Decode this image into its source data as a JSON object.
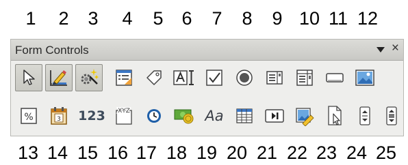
{
  "top_numbers": [
    "1",
    "2",
    "3",
    "4",
    "5",
    "6",
    "7",
    "8",
    "9",
    "10",
    "11",
    "12"
  ],
  "bottom_numbers": [
    "13",
    "14",
    "15",
    "16",
    "17",
    "18",
    "19",
    "20",
    "21",
    "22",
    "23",
    "24",
    "25"
  ],
  "toolbar": {
    "title": "Form Controls",
    "menu_icon": "dropdown-arrow-icon",
    "close_icon": "close-icon",
    "close_glyph": "×"
  },
  "row1": [
    {
      "icon": "select-pointer-icon",
      "active": true
    },
    {
      "icon": "design-mode-icon",
      "active": true
    },
    {
      "icon": "control-wizards-icon",
      "active": true
    },
    {
      "icon": "control-properties-icon",
      "active": false
    },
    {
      "icon": "label-tag-icon",
      "active": false
    },
    {
      "icon": "text-box-icon",
      "active": false
    },
    {
      "icon": "check-box-icon",
      "active": false
    },
    {
      "icon": "option-button-icon",
      "active": false
    },
    {
      "icon": "list-box-icon",
      "active": false
    },
    {
      "icon": "combo-box-icon",
      "active": false
    },
    {
      "icon": "push-button-icon",
      "active": false
    },
    {
      "icon": "image-button-icon",
      "active": false
    }
  ],
  "row2": [
    {
      "icon": "formatted-field-percent-icon",
      "text": "%"
    },
    {
      "icon": "date-field-icon",
      "text": "3"
    },
    {
      "icon": "numeric-field-icon",
      "text": "123"
    },
    {
      "icon": "pattern-field-icon",
      "text": "XYZ"
    },
    {
      "icon": "time-field-icon"
    },
    {
      "icon": "currency-field-icon"
    },
    {
      "icon": "font-field-icon",
      "text": "Aa"
    },
    {
      "icon": "table-control-icon"
    },
    {
      "icon": "navigation-bar-icon"
    },
    {
      "icon": "image-control-icon"
    },
    {
      "icon": "file-selection-icon"
    },
    {
      "icon": "spin-button-icon"
    },
    {
      "icon": "scrollbar-icon"
    }
  ]
}
